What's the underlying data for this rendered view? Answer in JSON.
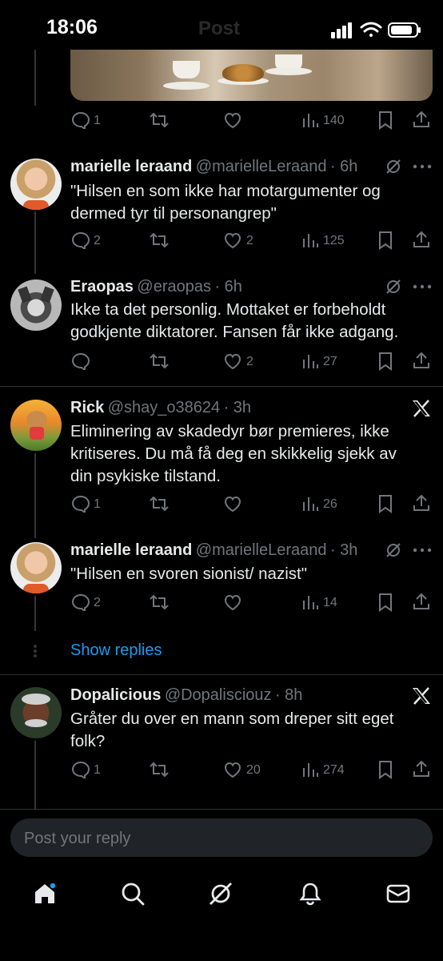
{
  "status_bar": {
    "time": "18:06",
    "ghost_title": "Post"
  },
  "top_post_actions": {
    "replies": "1",
    "reposts": "",
    "likes": "",
    "views": "140"
  },
  "replies": [
    {
      "name": "marielle leraand",
      "handle": "@marielleLeraand",
      "time": "· 6h",
      "text": "\"Hilsen en som ikke har motargumenter og dermed tyr til personangrep\"",
      "replies": "2",
      "likes": "2",
      "views": "125"
    },
    {
      "name": "Eraopas",
      "handle": "@eraopas",
      "time": "· 6h",
      "text": "Ikke ta det personlig. Mottaket er forbeholdt godkjente diktatorer. Fansen får ikke adgang.",
      "replies": "",
      "likes": "2",
      "views": "27"
    },
    {
      "name": "Rick",
      "handle": "@shay_o38624",
      "time": "· 3h",
      "text": "Eliminering av skadedyr bør premieres, ikke kritiseres. Du må få deg en skikkelig sjekk av din psykiske tilstand.",
      "replies": "1",
      "likes": "",
      "views": "26"
    },
    {
      "name": "marielle leraand",
      "handle": "@marielleLeraand",
      "time": "· 3h",
      "text": "\"Hilsen en svoren sionist/ nazist\"",
      "replies": "2",
      "likes": "",
      "views": "14"
    },
    {
      "name": "Dopalicious",
      "handle": "@Dopalisciouz",
      "time": "· 8h",
      "text": "Gråter du over en mann som dreper sitt eget folk?",
      "replies": "1",
      "likes": "20",
      "views": "274"
    }
  ],
  "show_replies": "Show replies",
  "reply_input": {
    "placeholder": "Post your reply"
  },
  "tabs": [
    "home-icon",
    "search-icon",
    "grok-icon",
    "notifications-icon",
    "messages-icon"
  ],
  "colors": {
    "accent": "#1d9bf0",
    "muted": "#71767b",
    "background": "#000000"
  }
}
